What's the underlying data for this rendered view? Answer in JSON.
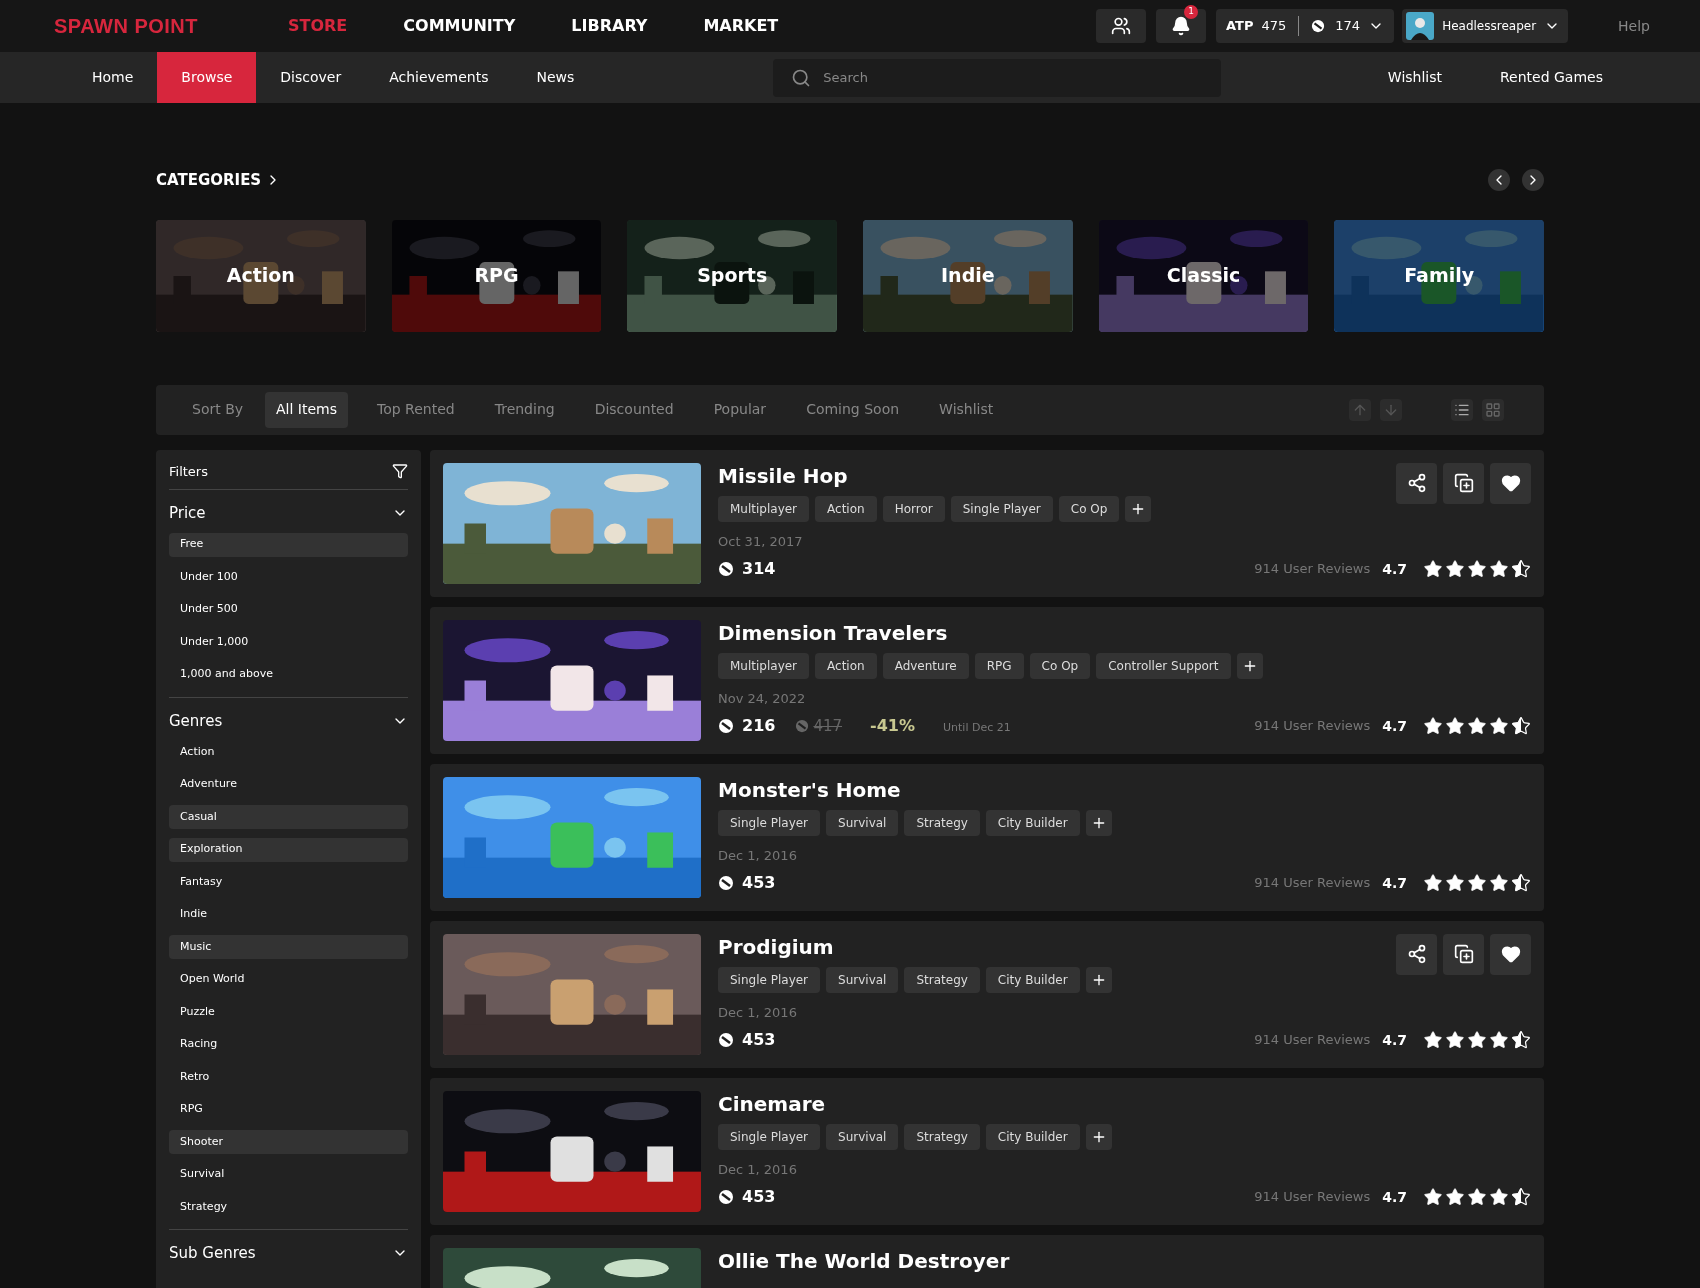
{
  "logo": "SPAWN POINT",
  "top_nav": [
    {
      "label": "STORE",
      "selected": true
    },
    {
      "label": "COMMUNITY",
      "selected": false
    },
    {
      "label": "LIBRARY",
      "selected": false
    },
    {
      "label": "MARKET",
      "selected": false
    }
  ],
  "notifications": {
    "count": "1"
  },
  "wallet": {
    "atp_label": "ATP",
    "atp": "475",
    "coins": "174"
  },
  "user": {
    "name": "Headlessreaper"
  },
  "help": "Help",
  "sub_nav": [
    {
      "label": "Home",
      "selected": false
    },
    {
      "label": "Browse",
      "selected": true
    },
    {
      "label": "Discover",
      "selected": false
    },
    {
      "label": "Achievements",
      "selected": false
    },
    {
      "label": "News",
      "selected": false
    }
  ],
  "search": {
    "placeholder": "Search"
  },
  "sub_nav_right": [
    "Wishlist",
    "Rented Games"
  ],
  "categories": {
    "title": "CATEGORIES",
    "items": [
      {
        "label": "Action"
      },
      {
        "label": "RPG"
      },
      {
        "label": "Sports"
      },
      {
        "label": "Indie"
      },
      {
        "label": "Classic"
      },
      {
        "label": "Family"
      }
    ]
  },
  "sort": {
    "label": "Sort By",
    "tabs": [
      {
        "label": "All Items",
        "selected": true
      },
      {
        "label": "Top Rented",
        "selected": false
      },
      {
        "label": "Trending",
        "selected": false
      },
      {
        "label": "Discounted",
        "selected": false
      },
      {
        "label": "Popular",
        "selected": false
      },
      {
        "label": "Coming Soon",
        "selected": false
      },
      {
        "label": "Wishlist",
        "selected": false
      }
    ],
    "view": [
      {
        "kind": "list",
        "selected": true
      },
      {
        "kind": "grid",
        "selected": false
      }
    ]
  },
  "filters": {
    "title": "Filters",
    "sections": [
      {
        "title": "Price",
        "items": [
          {
            "label": "Free",
            "selected": true
          },
          {
            "label": "Under 100",
            "selected": false
          },
          {
            "label": "Under 500",
            "selected": false
          },
          {
            "label": "Under 1,000",
            "selected": false
          },
          {
            "label": "1,000 and above",
            "selected": false
          }
        ]
      },
      {
        "title": "Genres",
        "items": [
          {
            "label": "Action",
            "selected": false
          },
          {
            "label": "Adventure",
            "selected": false
          },
          {
            "label": "Casual",
            "selected": true
          },
          {
            "label": "Exploration",
            "selected": true
          },
          {
            "label": "Fantasy",
            "selected": false
          },
          {
            "label": "Indie",
            "selected": false
          },
          {
            "label": "Music",
            "selected": true
          },
          {
            "label": "Open World",
            "selected": false
          },
          {
            "label": "Puzzle",
            "selected": false
          },
          {
            "label": "Racing",
            "selected": false
          },
          {
            "label": "Retro",
            "selected": false
          },
          {
            "label": "RPG",
            "selected": false
          },
          {
            "label": "Shooter",
            "selected": true
          },
          {
            "label": "Survival",
            "selected": false
          },
          {
            "label": "Strategy",
            "selected": false
          }
        ]
      },
      {
        "title": "Sub Genres"
      }
    ]
  },
  "games": [
    {
      "title": "Missile Hop",
      "tags": [
        "Multiplayer",
        "Action",
        "Horror",
        "Single Player",
        "Co Op"
      ],
      "date": "Oct 31, 2017",
      "price": "314",
      "reviews": "914 User Reviews",
      "rating": "4.7",
      "stars": 4.5,
      "actions_visible": true
    },
    {
      "title": "Dimension Travelers",
      "tags": [
        "Multiplayer",
        "Action",
        "Adventure",
        "RPG",
        "Co Op",
        "Controller Support"
      ],
      "date": "Nov 24, 2022",
      "price": "216",
      "old_price": "417",
      "discount": "-41%",
      "until": "Until Dec 21",
      "reviews": "914 User Reviews",
      "rating": "4.7",
      "stars": 4.5,
      "actions_visible": false
    },
    {
      "title": "Monster's Home",
      "tags": [
        "Single Player",
        "Survival",
        "Strategy",
        "City Builder"
      ],
      "date": "Dec 1, 2016",
      "price": "453",
      "reviews": "914 User Reviews",
      "rating": "4.7",
      "stars": 4.5,
      "actions_visible": false
    },
    {
      "title": "Prodigium",
      "tags": [
        "Single Player",
        "Survival",
        "Strategy",
        "City Builder"
      ],
      "date": "Dec 1, 2016",
      "price": "453",
      "reviews": "914 User Reviews",
      "rating": "4.7",
      "stars": 4.5,
      "actions_visible": true
    },
    {
      "title": "Cinemare",
      "tags": [
        "Single Player",
        "Survival",
        "Strategy",
        "City Builder"
      ],
      "date": "Dec 1, 2016",
      "price": "453",
      "reviews": "914 User Reviews",
      "rating": "4.7",
      "stars": 4.5,
      "actions_visible": false
    },
    {
      "title": "Ollie The World Destroyer",
      "actions_visible": false
    }
  ]
}
